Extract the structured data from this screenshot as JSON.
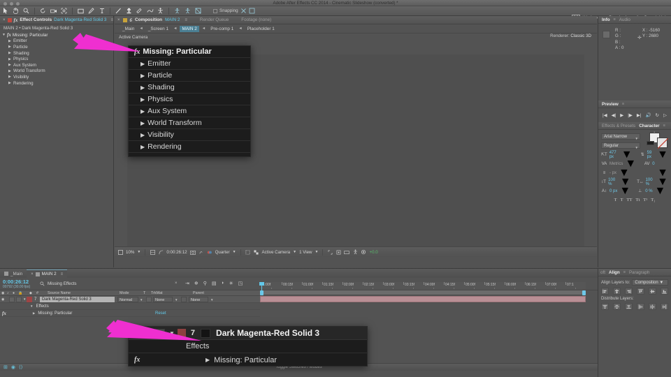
{
  "window": {
    "title": "Adobe After Effects CC 2014 - Cinematic Slideshow (converted) *"
  },
  "toolbar": {
    "snapping_label": "Snapping",
    "workspace_label": "Workspace:",
    "workspace_value": "Standard",
    "search_help": "Search Help",
    "tools": [
      "selection-tool",
      "hand-tool",
      "zoom-tool",
      "rotation-tool",
      "camera-tool",
      "pan-behind-tool",
      "shape-tool",
      "pen-tool",
      "text-tool",
      "brush-tool",
      "clone-stamp-tool",
      "eraser-tool",
      "roto-brush-tool",
      "puppet-tool"
    ]
  },
  "effect_controls": {
    "tab_label": "Effect Controls",
    "tab_target": "Dark Magenta-Red Solid 3",
    "breadcrumb": "MAIN 2 • Dark Magenta-Red Solid 3",
    "root": "Missing: Particular",
    "properties": [
      "Emitter",
      "Particle",
      "Shading",
      "Physics",
      "Aux System",
      "World Transform",
      "Visibility",
      "Rendering"
    ]
  },
  "composition": {
    "tab_label": "Composition",
    "tab_comp": "MAIN 2",
    "render_queue": "Render Queue",
    "footage": "Footage (none)",
    "nav_tabs": [
      {
        "label": "_Main",
        "active": false
      },
      {
        "label": "_Screen 1",
        "active": false
      },
      {
        "label": "MAIN 2",
        "active": true
      },
      {
        "label": "Pre-comp 1",
        "active": false
      },
      {
        "label": "Placeholder 1",
        "active": false
      }
    ],
    "renderer_label": "Renderer:",
    "renderer_value": "Classic 3D",
    "active_camera": "Active Camera",
    "viewer_bar": {
      "zoom": "10%",
      "timecode": "0:00:26:12",
      "resolution": "Quarter",
      "camera": "Active Camera",
      "views": "1 View",
      "exposure": "+0.0"
    }
  },
  "info_panel": {
    "tabs": [
      "Info",
      "Audio"
    ],
    "active_tab": "Info",
    "channels": [
      "R :",
      "G :",
      "B :",
      "A : 0"
    ],
    "coord_x": "X : -5160",
    "coord_y": "Y : 2680"
  },
  "preview_panel": {
    "title": "Preview",
    "buttons": [
      "first-frame",
      "prev-frame",
      "play",
      "next-frame",
      "last-frame",
      "audio",
      "loop",
      "ram-preview"
    ]
  },
  "character_panel": {
    "tabs": [
      "Effects & Presets",
      "Character"
    ],
    "active_tab": "Character",
    "font_family": "Arial Narrow",
    "font_style": "Regular",
    "font_size": "477 px",
    "leading": "59 px",
    "kerning": "Metrics",
    "tracking": "0",
    "baseline_shift": "- px",
    "vertical_scale": "100 %",
    "horizontal_scale": "100 %",
    "stroke_width": "0 px",
    "tsume": "0 %",
    "style_toggles": [
      "T",
      "T",
      "TT",
      "Tt",
      "T¹",
      "T₁"
    ]
  },
  "timeline": {
    "tabs": [
      {
        "label": "_Main",
        "active": false
      },
      {
        "label": "MAIN 2",
        "active": true
      }
    ],
    "timecode": "0:00:26:12",
    "frames": "00792 (30.00 fps)",
    "search_value": "Missing Effects",
    "columns": [
      "#",
      "Source Name",
      "Mode",
      "T",
      "TrkMat",
      "Parent"
    ],
    "layer": {
      "number": "7",
      "name": "Dark Magenta-Red Solid 3",
      "mode": "Normal",
      "trkmat": "None",
      "parent": "None"
    },
    "effects_group": "Effects",
    "effect_name": "Missing: Particular",
    "reset_label": "Reset",
    "ruler_labels": [
      "1:00f",
      "00:15f",
      "01:00f",
      "01:15f",
      "02:00f",
      "02:15f",
      "03:00f",
      "03:15f",
      "04:00f",
      "04:15f",
      "05:00f",
      "05:15f",
      "06:00f",
      "06:15f",
      "07:00f",
      "07:1"
    ],
    "toggle_switches": "Toggle Switches / Modes"
  },
  "align_panel": {
    "tabs": [
      "oft",
      "Align",
      "Paragraph"
    ],
    "active_tab": "Align",
    "align_layers_label": "Align Layers to:",
    "align_layers_value": "Composition",
    "distribute_label": "Distribute Layers:"
  },
  "overlay_effect_controls": {
    "title": "Missing: Particular",
    "items": [
      "Emitter",
      "Particle",
      "Shading",
      "Physics",
      "Aux System",
      "World Transform",
      "Visibility",
      "Rendering"
    ]
  },
  "overlay_timeline": {
    "layer_number": "7",
    "layer_name": "Dark Magenta-Red Solid 3",
    "effects_label": "Effects",
    "effect_name": "Missing: Particular"
  },
  "colors": {
    "accent_blue": "#62c7e8",
    "arrow_pink": "#ef2fd0",
    "panel_bg": "#535353",
    "overlay_bg": "#1c1c1c",
    "clip_bar": "#b98f95"
  }
}
